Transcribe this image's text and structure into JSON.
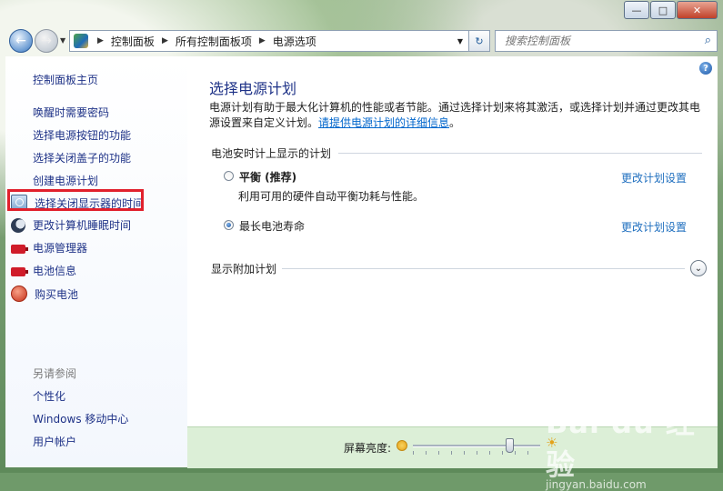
{
  "window": {
    "minimize": "—",
    "maximize": "□",
    "close": "✕"
  },
  "address_bar": {
    "breadcrumbs": [
      "控制面板",
      "所有控制面板项",
      "电源选项"
    ],
    "back_icon": "back-arrow-icon",
    "forward_icon": "forward-arrow-icon"
  },
  "search": {
    "placeholder": "搜索控制面板"
  },
  "sidebar": {
    "home": "控制面板主页",
    "links": [
      "唤醒时需要密码",
      "选择电源按钮的功能",
      "选择关闭盖子的功能",
      "创建电源计划"
    ],
    "icon_links": [
      {
        "label": "选择关闭显示器的时间",
        "icon": "monitor-icon"
      },
      {
        "label": "更改计算机睡眠时间",
        "icon": "moon-icon"
      },
      {
        "label": "电源管理器",
        "icon": "battery-icon"
      },
      {
        "label": "电池信息",
        "icon": "battery-icon"
      },
      {
        "label": "购买电池",
        "icon": "globe-icon"
      }
    ],
    "see_also_title": "另请参阅",
    "see_also": [
      "个性化",
      "Windows 移动中心",
      "用户帐户"
    ]
  },
  "main": {
    "title": "选择电源计划",
    "description_prefix": "电源计划有助于最大化计算机的性能或者节能。通过选择计划来将其激活，或选择计划并通过更改其电源设置来自定义计划。",
    "description_link": "请提供电源计划的详细信息",
    "description_suffix": "。",
    "group_label": "电池安时计上显示的计划",
    "plans": [
      {
        "name": "平衡 (推荐)",
        "desc": "利用可用的硬件自动平衡功耗与性能。",
        "selected": false,
        "change": "更改计划设置"
      },
      {
        "name": "最长电池寿命",
        "desc": "",
        "selected": true,
        "change": "更改计划设置"
      }
    ],
    "more_plans": "显示附加计划"
  },
  "footer": {
    "brightness_label": "屏幕亮度:",
    "brightness_level": 0.78
  },
  "watermark": {
    "text": "Bai du 经验",
    "url": "jingyan.baidu.com"
  }
}
